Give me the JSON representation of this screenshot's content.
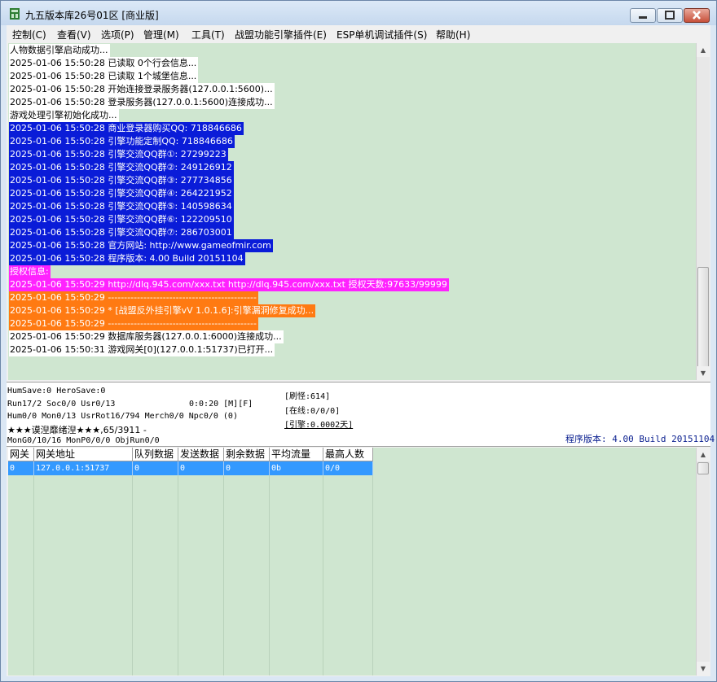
{
  "window": {
    "title": "九五版本库26号01区 [商业版]"
  },
  "menu": [
    "控制(C)",
    "查看(V)",
    "选项(P)",
    "管理(M)",
    "工具(T)",
    "战盟功能引擎插件(E)",
    "ESP单机调试插件(S)",
    "帮助(H)"
  ],
  "log": [
    {
      "text": "人物数据引擎启动成功...",
      "style": "white"
    },
    {
      "text": "2025-01-06 15:50:28 已读取 0个行会信息...",
      "style": "white"
    },
    {
      "text": "2025-01-06 15:50:28 已读取 1个城堡信息...",
      "style": "white"
    },
    {
      "text": "2025-01-06 15:50:28 开始连接登录服务器(127.0.0.1:5600)...",
      "style": "white"
    },
    {
      "text": "2025-01-06 15:50:28 登录服务器(127.0.0.1:5600)连接成功...",
      "style": "white"
    },
    {
      "text": "游戏处理引擎初始化成功...",
      "style": "white"
    },
    {
      "text": "2025-01-06 15:50:28 商业登录器购买QQ: 718846686",
      "style": "blue"
    },
    {
      "text": "2025-01-06 15:50:28 引擎功能定制QQ: 718846686",
      "style": "blue"
    },
    {
      "text": "2025-01-06 15:50:28 引擎交流QQ群①: 27299223",
      "style": "blue"
    },
    {
      "text": "2025-01-06 15:50:28 引擎交流QQ群②: 249126912",
      "style": "blue"
    },
    {
      "text": "2025-01-06 15:50:28 引擎交流QQ群③: 277734856",
      "style": "blue"
    },
    {
      "text": "2025-01-06 15:50:28 引擎交流QQ群④: 264221952",
      "style": "blue"
    },
    {
      "text": "2025-01-06 15:50:28 引擎交流QQ群⑤: 140598634",
      "style": "blue"
    },
    {
      "text": "2025-01-06 15:50:28 引擎交流QQ群⑥: 122209510",
      "style": "blue"
    },
    {
      "text": "2025-01-06 15:50:28 引擎交流QQ群⑦: 286703001",
      "style": "blue"
    },
    {
      "text": "2025-01-06 15:50:28 官方网站: http://www.gameofmir.com",
      "style": "blue"
    },
    {
      "text": "2025-01-06 15:50:28 程序版本: 4.00 Build 20151104",
      "style": "blue"
    },
    {
      "text": "授权信息:",
      "style": "mag"
    },
    {
      "text": "2025-01-06 15:50:29 http://dlq.945.com/xxx.txt http://dlq.945.com/xxx.txt 授权天数:97633/99999",
      "style": "mag"
    },
    {
      "text": "2025-01-06 15:50:29 ----------------------------------------------",
      "style": "orange"
    },
    {
      "text": "2025-01-06 15:50:29 * [战盟反外挂引擎vV 1.0.1.6]:引擎漏洞修复成功...",
      "style": "orange"
    },
    {
      "text": "2025-01-06 15:50:29 ----------------------------------------------",
      "style": "orange"
    },
    {
      "text": "2025-01-06 15:50:29 数据库服务器(127.0.0.1:6000)连接成功...",
      "style": "white"
    },
    {
      "text": "2025-01-06 15:50:31 游戏网关[0](127.0.0.1:51737)已打开...",
      "style": "white"
    }
  ],
  "status": {
    "line1": "HumSave:0 HeroSave:0",
    "line2a": "Run17/2 Soc0/0 Usr0/13",
    "line2b": "0:0:20 [M][F]",
    "line3": "Hum0/0 Mon0/13 UsrRot16/794 Merch0/0 Npc0/0 (0)",
    "line4": "★★★谟湼靡绪湼★★★,65/3911 -",
    "line5": "MonG0/10/16 MonP0/0/0 ObjRun0/0",
    "refresh": "[刷怪:614]",
    "online": "[在线:0/0/0]",
    "engine": "[引擎:0.0002天]",
    "version": "程序版本: 4.00 Build 20151104"
  },
  "grid": {
    "headers": [
      "网关",
      "网关地址",
      "队列数据",
      "发送数据",
      "剩余数据",
      "平均流量",
      "最高人数"
    ],
    "rows": [
      [
        "0",
        "127.0.0.1:51737",
        "0",
        "0",
        "0",
        "0b",
        "0/0"
      ]
    ]
  }
}
